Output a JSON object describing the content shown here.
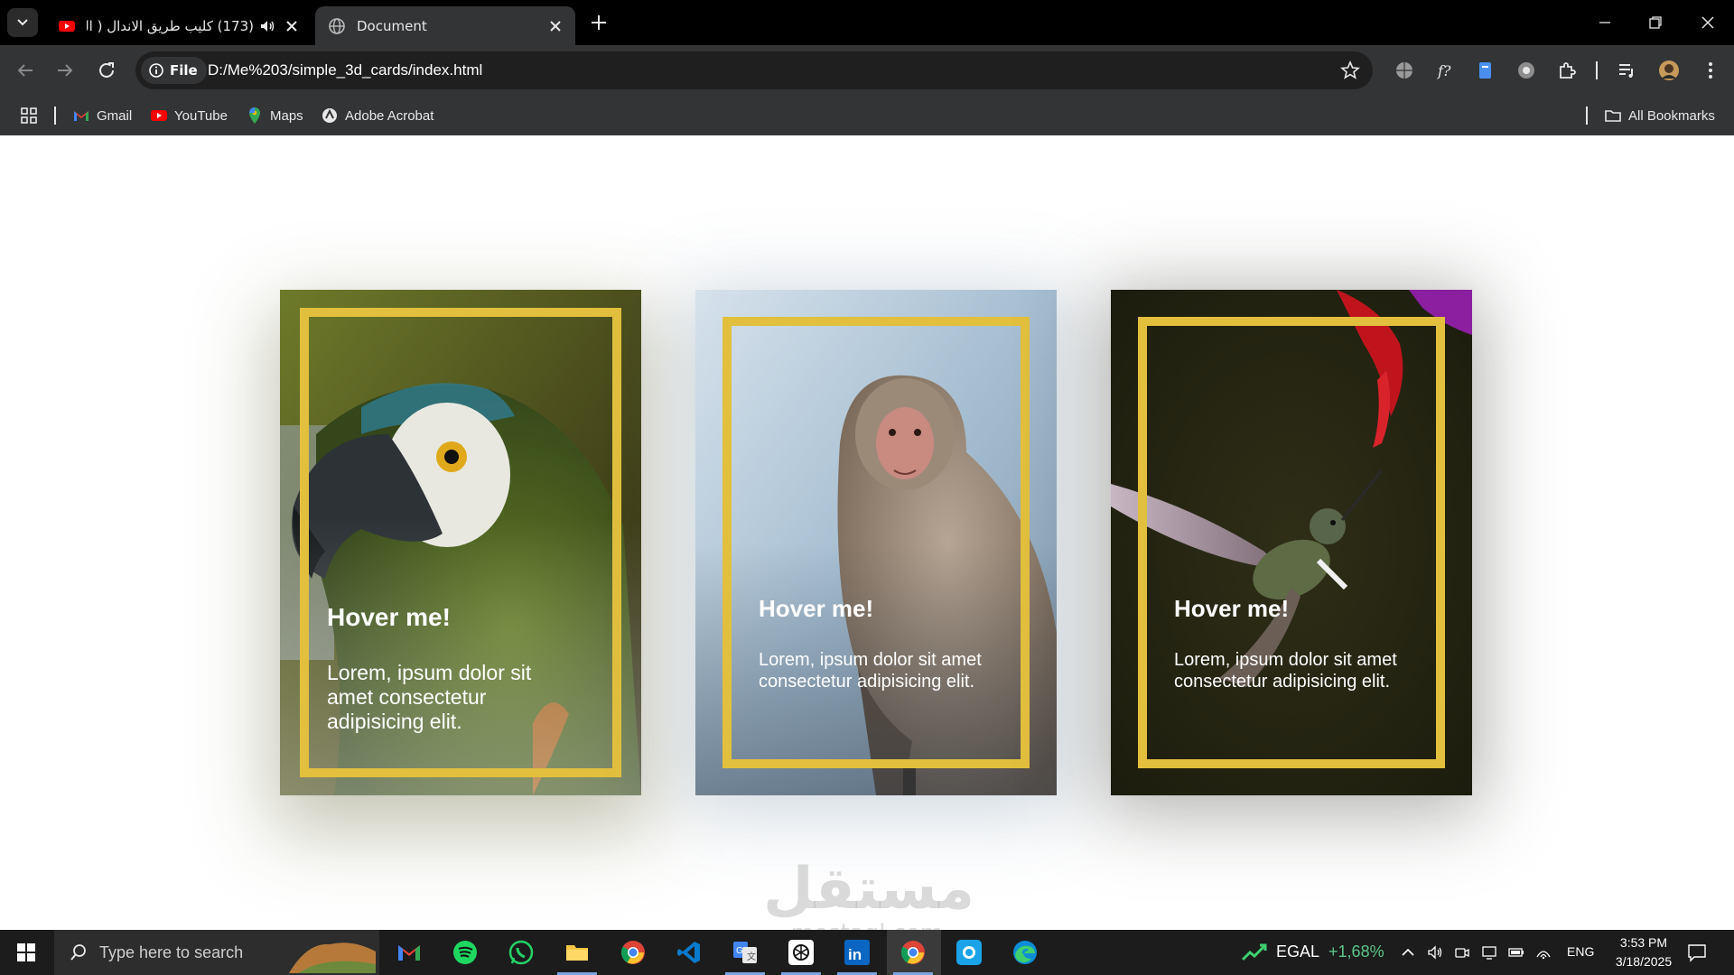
{
  "browser": {
    "tabs": [
      {
        "title": "(173) كليب طريق الاندال ( الـ",
        "active": false,
        "favicon": "youtube-icon",
        "audio": true
      },
      {
        "title": "Document",
        "active": true,
        "favicon": "globe-icon",
        "audio": false
      }
    ],
    "address": {
      "chip_label": "File",
      "url": "D:/Me%203/simple_3d_cards/index.html"
    },
    "bookmarks": [
      {
        "label": "Gmail",
        "icon": "gmail-icon"
      },
      {
        "label": "YouTube",
        "icon": "youtube-icon"
      },
      {
        "label": "Maps",
        "icon": "maps-icon"
      },
      {
        "label": "Adobe Acrobat",
        "icon": "acrobat-icon"
      }
    ],
    "all_bookmarks_label": "All Bookmarks"
  },
  "cards": [
    {
      "title": "Hover me!",
      "text": "Lorem, ipsum dolor sit amet consectetur adipisicing elit.",
      "image": "parrot"
    },
    {
      "title": "Hover me!",
      "text": "Lorem, ipsum dolor sit amet consectetur adipisicing elit.",
      "image": "monkey"
    },
    {
      "title": "Hover me!",
      "text": "Lorem, ipsum dolor sit amet consectetur adipisicing elit.",
      "image": "hummingbird"
    }
  ],
  "watermark": {
    "arabic": "مستقل",
    "latin": "mostaql.com"
  },
  "taskbar": {
    "search_placeholder": "Type here to search",
    "apps": [
      "gmail-icon",
      "spotify-icon",
      "whatsapp-icon",
      "file-explorer-icon",
      "chrome-icon",
      "vscode-icon",
      "google-translate-icon",
      "chatgpt-icon",
      "linkedin-icon",
      "chrome-icon",
      "camera-app-icon",
      "edge-icon"
    ],
    "stock": {
      "symbol": "EGAL",
      "change": "+1,68%"
    },
    "language": "ENG",
    "time": "3:53 PM",
    "date": "3/18/2025"
  },
  "colors": {
    "frame": "#e2bf3d",
    "titlebar": "#000000",
    "toolbar": "#333436",
    "taskbar": "#1c1c1c"
  }
}
